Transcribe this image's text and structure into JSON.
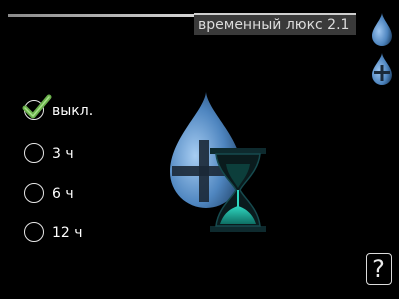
{
  "header": {
    "title": "временный люкс 2.1"
  },
  "options": [
    {
      "label": "выкл.",
      "selected": true
    },
    {
      "label": "3 ч",
      "selected": false
    },
    {
      "label": "6 ч",
      "selected": false
    },
    {
      "label": "12 ч",
      "selected": false
    }
  ],
  "help": {
    "label": "?"
  },
  "icons": {
    "scale_top": "water-drop-icon",
    "scale_bottom": "water-drop-plus-icon",
    "center": "hot-water-luxury-timer-icon",
    "help": "help-icon",
    "checkmark": "checkmark-icon"
  },
  "colors": {
    "background": "#000000",
    "drop_blue": "#4f86c0",
    "hourglass_teal": "#2fd7c0",
    "check_green": "#6ab04c",
    "title_box": "#3a3a3a"
  }
}
